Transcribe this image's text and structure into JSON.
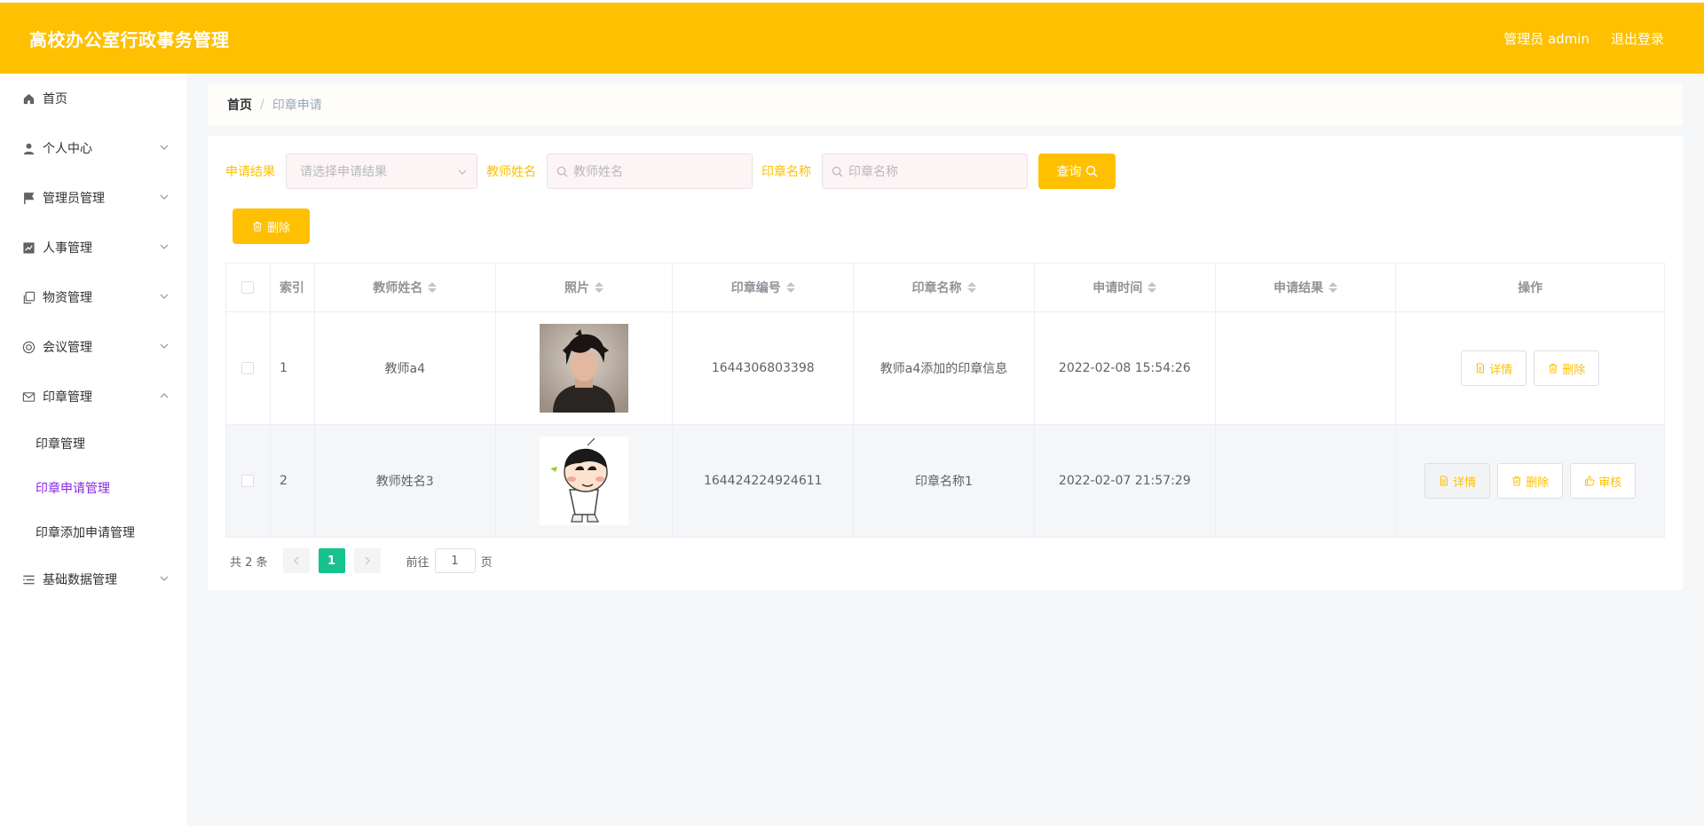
{
  "header": {
    "title": "高校办公室行政事务管理",
    "user": "管理员 admin",
    "logout": "退出登录"
  },
  "sidebar": {
    "items": [
      {
        "label": "首页",
        "icon": "home-icon"
      },
      {
        "label": "个人中心",
        "icon": "user-icon"
      },
      {
        "label": "管理员管理",
        "icon": "flag-icon"
      },
      {
        "label": "人事管理",
        "icon": "chart-icon"
      },
      {
        "label": "物资管理",
        "icon": "copy-icon"
      },
      {
        "label": "会议管理",
        "icon": "lifebuoy-icon"
      },
      {
        "label": "印章管理",
        "icon": "mail-icon"
      },
      {
        "label": "基础数据管理",
        "icon": "list-icon"
      }
    ],
    "sub_items": [
      {
        "label": "印章管理"
      },
      {
        "label": "印章申请管理"
      },
      {
        "label": "印章添加申请管理"
      }
    ]
  },
  "breadcrumb": {
    "home": "首页",
    "separator": "/",
    "current": "印章申请"
  },
  "filters": {
    "result_label": "申请结果",
    "result_placeholder": "请选择申请结果",
    "teacher_label": "教师姓名",
    "teacher_placeholder": "教师姓名",
    "seal_label": "印章名称",
    "seal_placeholder": "印章名称",
    "query_button": "查询"
  },
  "actions": {
    "delete_button": "删除"
  },
  "table": {
    "columns": [
      "索引",
      "教师姓名",
      "照片",
      "印章编号",
      "印章名称",
      "申请时间",
      "申请结果",
      "操作"
    ],
    "rows": [
      {
        "index": "1",
        "teacher": "教师a4",
        "seal_no": "1644306803398",
        "seal_name": "教师a4添加的印章信息",
        "time": "2022-02-08 15:54:26",
        "result": "",
        "ops": [
          "详情",
          "删除"
        ]
      },
      {
        "index": "2",
        "teacher": "教师姓名3",
        "seal_no": "164424224924611",
        "seal_name": "印章名称1",
        "time": "2022-02-07 21:57:29",
        "result": "",
        "ops": [
          "详情",
          "删除",
          "审核"
        ]
      }
    ]
  },
  "pagination": {
    "total": "共 2 条",
    "current_page": "1",
    "goto_label": "前往",
    "goto_value": "1",
    "page_unit": "页"
  },
  "colors": {
    "brand": "#fec000",
    "active_menu": "#8a2be2",
    "pager_active": "#17c28f"
  }
}
